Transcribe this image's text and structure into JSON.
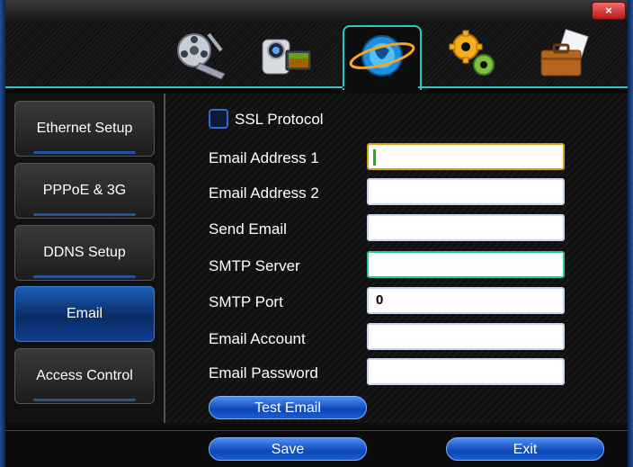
{
  "window": {
    "close_label": "×"
  },
  "toolbar": {
    "icons": [
      {
        "name": "video-reel-icon"
      },
      {
        "name": "camcorder-icon"
      },
      {
        "name": "network-globe-icon",
        "selected": true
      },
      {
        "name": "settings-gears-icon"
      },
      {
        "name": "briefcase-icon"
      }
    ]
  },
  "sidebar": {
    "items": [
      {
        "label": "Ethernet Setup",
        "active": false
      },
      {
        "label": "PPPoE & 3G",
        "active": false
      },
      {
        "label": "DDNS Setup",
        "active": false
      },
      {
        "label": "Email",
        "active": true
      },
      {
        "label": "Access Control",
        "active": false
      }
    ]
  },
  "form": {
    "ssl_protocol": {
      "label": "SSL Protocol",
      "checked": false
    },
    "email_address_1": {
      "label": "Email Address 1",
      "value": ""
    },
    "email_address_2": {
      "label": "Email Address 2",
      "value": ""
    },
    "send_email": {
      "label": "Send Email",
      "value": ""
    },
    "smtp_server": {
      "label": "SMTP Server",
      "value": ""
    },
    "smtp_port": {
      "label": "SMTP Port",
      "value": "0"
    },
    "email_account": {
      "label": "Email Account",
      "value": ""
    },
    "email_password": {
      "label": "Email Password",
      "value": ""
    },
    "test_email_label": "Test Email"
  },
  "footer": {
    "save_label": "Save",
    "exit_label": "Exit"
  },
  "colors": {
    "accent": "#2ec6c6",
    "active_blue": "#0c47b8",
    "close_red": "#d12a2a"
  }
}
